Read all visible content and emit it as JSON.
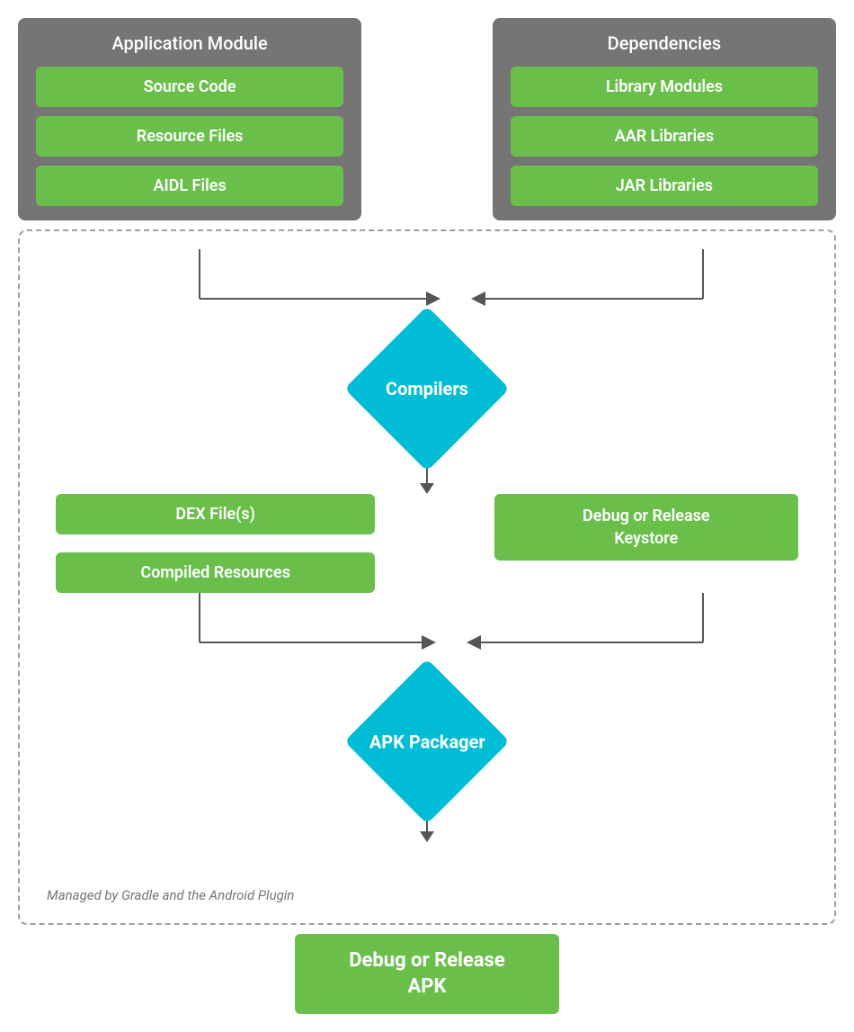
{
  "app_module": {
    "title": "Application Module",
    "items": [
      "Source Code",
      "Resource Files",
      "AIDL Files"
    ]
  },
  "dependencies": {
    "title": "Dependencies",
    "items": [
      "Library Modules",
      "AAR Libraries",
      "JAR Libraries"
    ]
  },
  "compilers": {
    "label": "Compilers"
  },
  "dex_files": {
    "label": "DEX File(s)"
  },
  "compiled_resources": {
    "label": "Compiled Resources"
  },
  "keystore": {
    "label": "Debug or Release\nKeystore"
  },
  "apk_packager": {
    "label": "APK\nPackager"
  },
  "final_output": {
    "label": "Debug or Release\nAPK"
  },
  "gradle_label": "Managed by Gradle\nand the Android Plugin"
}
